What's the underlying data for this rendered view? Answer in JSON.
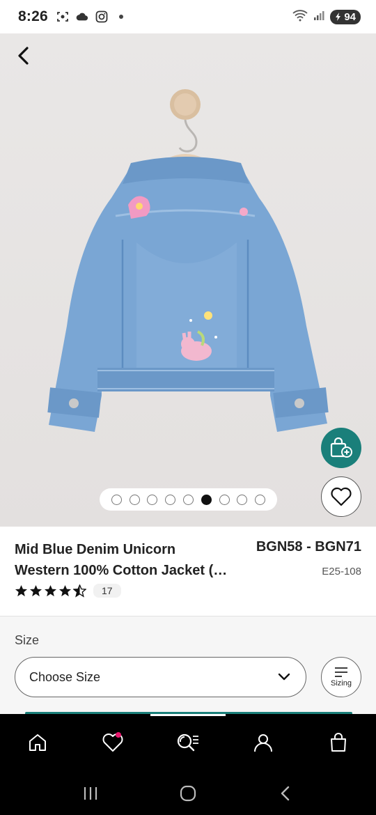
{
  "status_bar": {
    "time": "8:26",
    "battery": "94",
    "icons": [
      "screenshot-icon",
      "cloud-icon",
      "instagram-icon",
      "notification-dot-icon",
      "wifi-icon",
      "signal-icon",
      "battery-icon"
    ]
  },
  "hero": {
    "back_icon": "chevron-left-icon",
    "carousel": {
      "total": 9,
      "active_index": 5
    },
    "add_to_bag_icon": "bag-plus-icon",
    "favourite_icon": "heart-icon"
  },
  "product": {
    "title_line1": "Mid Blue Denim Unicorn",
    "title_line2": "Western 100% Cotton Jacket (…",
    "price": "BGN58 - BGN71",
    "code": "E25-108",
    "rating": 4.5,
    "review_count": "17"
  },
  "size": {
    "label": "Size",
    "select_placeholder": "Choose Size",
    "sizing_label": "Sizing"
  },
  "bottom_nav": {
    "items": [
      "home-icon",
      "favourites-icon",
      "search-icon",
      "account-icon",
      "bag-icon"
    ],
    "active_index": 2
  },
  "system_nav": [
    "recents-icon",
    "home-circle-icon",
    "back-icon"
  ],
  "colors": {
    "accent": "#1a7f7a",
    "notification": "#e8186e",
    "denim": "#7aa6d4"
  }
}
